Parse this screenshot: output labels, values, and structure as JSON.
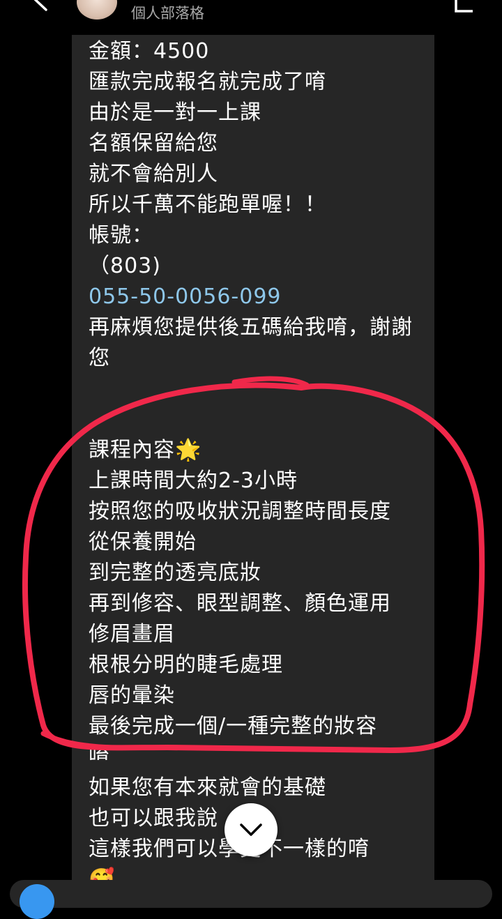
{
  "header": {
    "subtitle": "個人部落格",
    "back_icon": "chevron-left-icon",
    "right_icon": "flag-icon"
  },
  "message": {
    "lines_top": [
      "金額：4500",
      "匯款完成報名就完成了唷",
      "由於是一對一上課",
      "名額保留給您",
      "就不會給別人",
      "所以千萬不能跑單喔！！",
      "帳號：",
      "（803)"
    ],
    "account_number": "055-50-0056-099",
    "closing": "再麻煩您提供後五碼給我唷，謝謝您",
    "course_title": "課程內容",
    "course_emoji": "🌟",
    "course_lines": [
      "上課時間大約2-3小時",
      "按照您的吸收狀況調整時間長度",
      "從保養開始",
      "到完整的透亮底妝",
      "再到修容、眼型調整、顏色運用",
      "修眉畫眉",
      "根根分明的睫毛處理",
      "唇的暈染",
      "最後完成一個/一種完整的妝容",
      "唷"
    ],
    "extra_lines": [
      "如果您有本來就會的基礎",
      "也可以跟我說",
      "這樣我們可以學更不一樣的唷"
    ],
    "trailing_emoji": "🥰"
  },
  "annotation": {
    "circle_color": "#f0284a"
  },
  "scroll_button": {
    "icon": "chevron-down-icon"
  }
}
